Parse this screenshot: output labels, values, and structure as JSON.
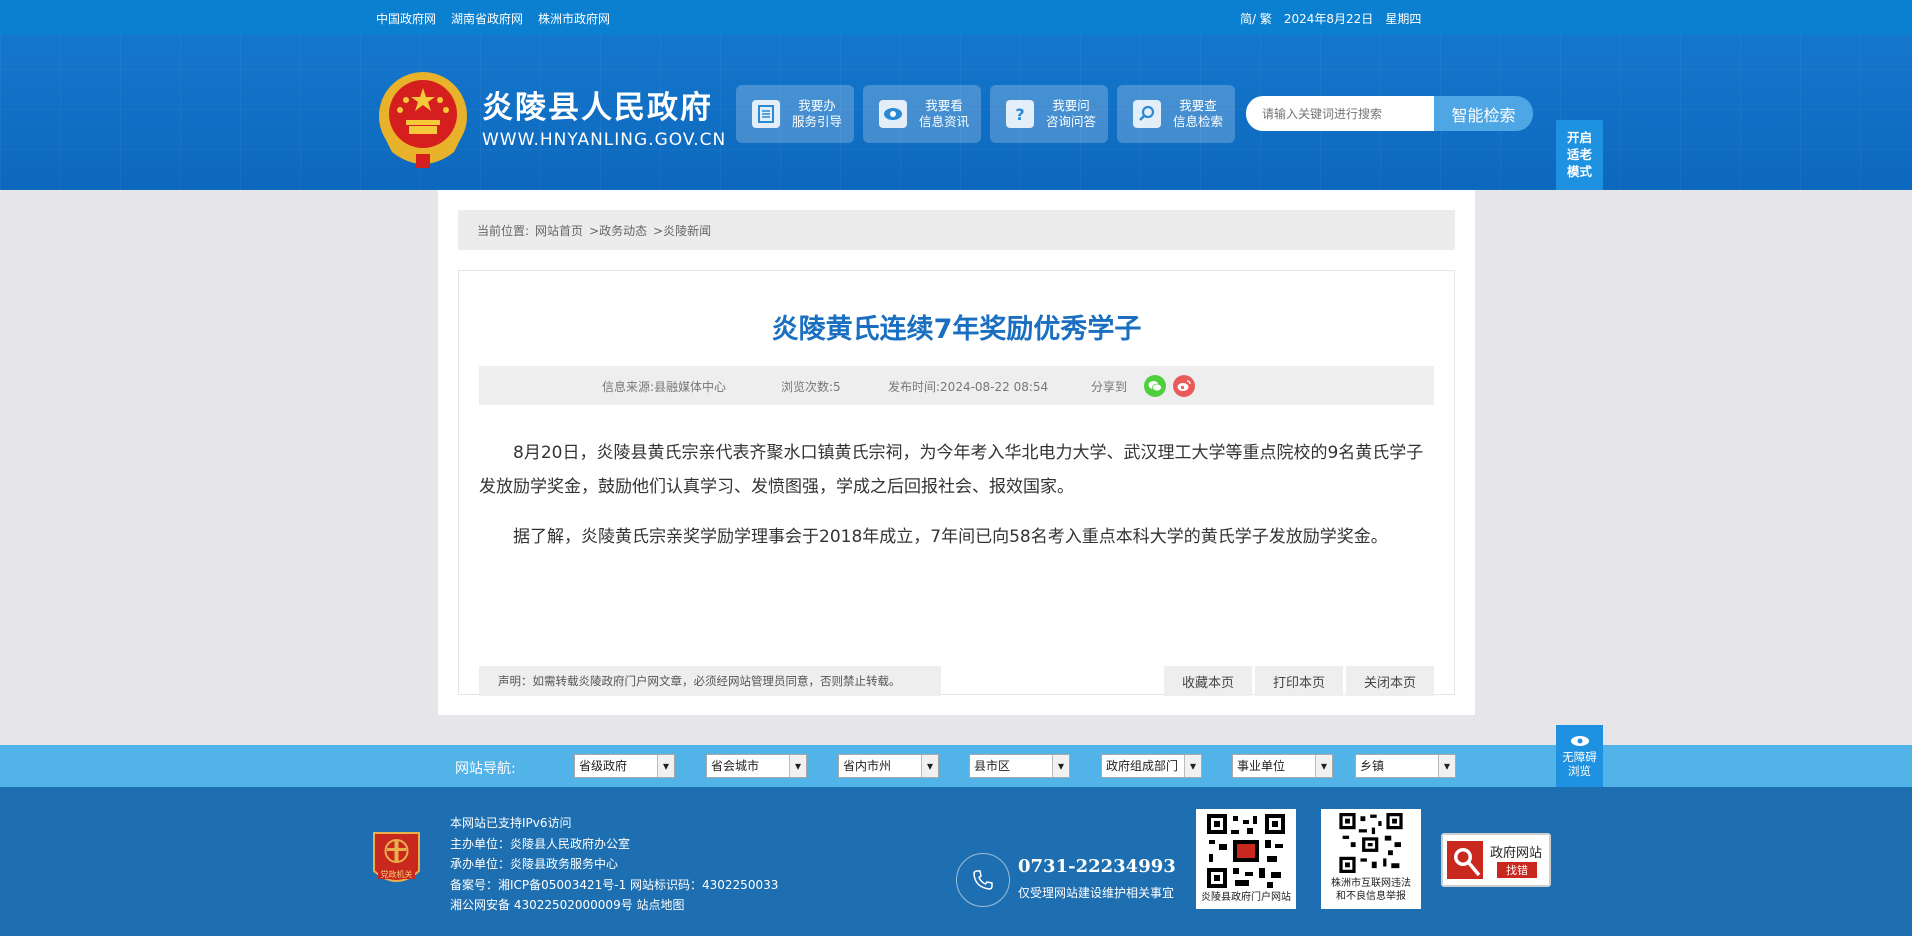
{
  "topbar": {
    "links": [
      "中国政府网",
      "湖南省政府网",
      "株洲市政府网"
    ],
    "lang": "简/ 繁",
    "date": "2024年8月22日",
    "weekday": "星期四"
  },
  "header": {
    "title": "炎陵县人民政府",
    "url": "WWW.HNYANLING.GOV.CN",
    "services": [
      {
        "line1": "我要办",
        "line2": "服务引导",
        "icon": "doc-icon"
      },
      {
        "line1": "我要看",
        "line2": "信息资讯",
        "icon": "eye-icon"
      },
      {
        "line1": "我要问",
        "line2": "咨询问答",
        "icon": "question-icon"
      },
      {
        "line1": "我要查",
        "line2": "信息检索",
        "icon": "search-icon"
      }
    ],
    "search_placeholder": "请输入关键词进行搜索",
    "search_button": "智能检索",
    "elder_mode": [
      "开启",
      "适老",
      "模式"
    ]
  },
  "breadcrumb": {
    "label": "当前位置:",
    "items": [
      "网站首页",
      ">政务动态",
      ">炎陵新闻"
    ]
  },
  "article": {
    "title": "炎陵黄氏连续7年奖励优秀学子",
    "source": "信息来源:县融媒体中心",
    "views": "浏览次数:5",
    "published": "发布时间:2024-08-22 08:54",
    "share_label": "分享到",
    "paragraphs": [
      "8月20日，炎陵县黄氏宗亲代表齐聚水口镇黄氏宗祠，为今年考入华北电力大学、武汉理工大学等重点院校的9名黄氏学子发放励学奖金，鼓励他们认真学习、发愤图强，学成之后回报社会、报效国家。",
      "据了解，炎陵黄氏宗亲奖学励学理事会于2018年成立，7年间已向58名考入重点本科大学的黄氏学子发放励学奖金。"
    ],
    "notice": "声明：如需转载炎陵政府门户网文章，必须经网站管理员同意，否则禁止转载。",
    "actions": [
      "收藏本页",
      "打印本页",
      "关闭本页"
    ]
  },
  "navbar": {
    "label": "网站导航:",
    "selects": [
      "省级政府",
      "省会城市",
      "省内市州",
      "县市区",
      "政府组成部门",
      "事业单位",
      "乡镇"
    ],
    "barrier_free": [
      "无障碍",
      "浏览"
    ]
  },
  "footer": {
    "badge_text": "党政机关",
    "lines": [
      "本网站已支持IPv6访问",
      "主办单位：炎陵县人民政府办公室",
      "承办单位：炎陵县政务服务中心",
      "备案号：湘ICP备05003421号-1 网站标识码：4302250033",
      "湘公网安备 43022502000009号 站点地图"
    ],
    "phone": "0731-22234993",
    "phone_note": "仅受理网站建设维护相关事宜",
    "qr1_caption": "炎陵县政府门户网站",
    "qr2_caption_1": "株洲市互联网违法",
    "qr2_caption_2": "和不良信息举报",
    "jiucuo_1": "政府网站",
    "jiucuo_2": "找错"
  },
  "colors": {
    "brand_blue": "#0c68bd",
    "title_blue": "#1a6fc0",
    "nav_blue": "#52b3e8",
    "footer_blue": "#1e6fb1"
  }
}
